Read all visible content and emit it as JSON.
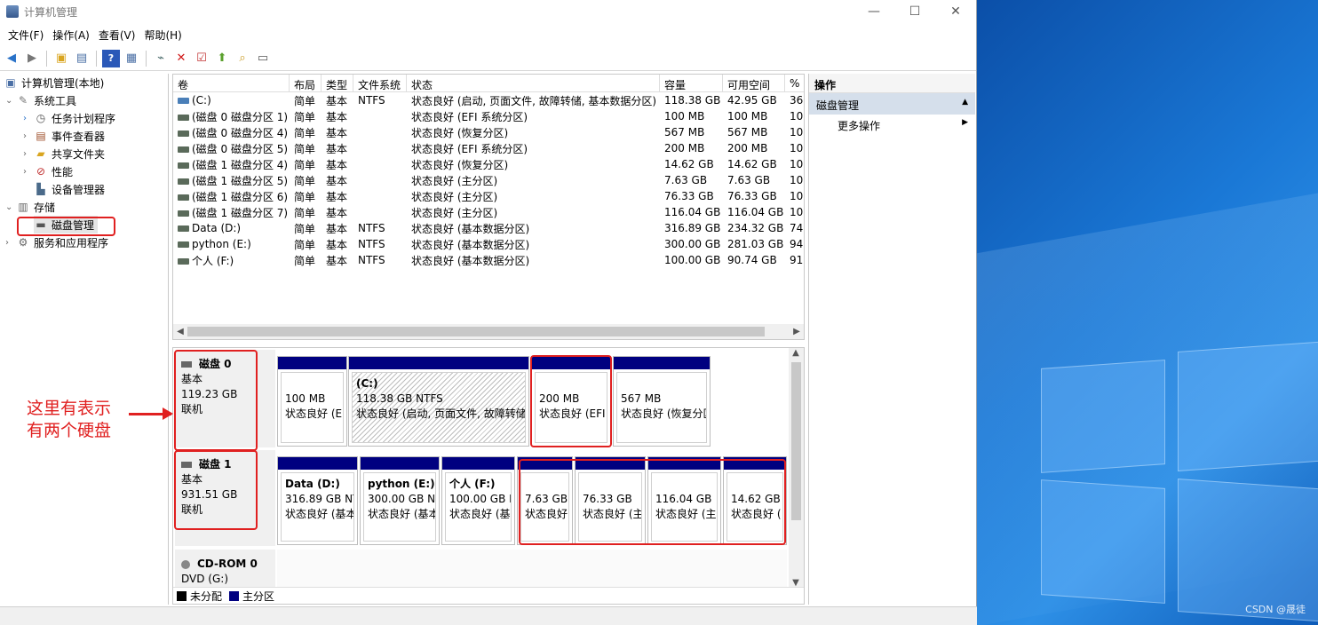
{
  "window": {
    "title": "计算机管理",
    "controls": {
      "minimize": "—",
      "maximize": "☐",
      "close": "✕"
    }
  },
  "menu": [
    "文件(F)",
    "操作(A)",
    "查看(V)",
    "帮助(H)"
  ],
  "toolbar_icons": [
    "back-icon",
    "forward-icon",
    "up-folder-icon",
    "show-hide-tree-icon",
    "help-icon",
    "properties-icon",
    "connect-icon",
    "delete-icon",
    "check-icon",
    "import-icon",
    "search-icon",
    "view-icon"
  ],
  "tree": {
    "root": "计算机管理(本地)",
    "system_tools": "系统工具",
    "task_scheduler": "任务计划程序",
    "event_viewer": "事件查看器",
    "shared_folders": "共享文件夹",
    "performance": "性能",
    "device_manager": "设备管理器",
    "storage": "存储",
    "disk_management": "磁盘管理",
    "services": "服务和应用程序"
  },
  "volumes": {
    "columns": [
      "卷",
      "布局",
      "类型",
      "文件系统",
      "状态",
      "容量",
      "可用空间",
      "%"
    ],
    "rows": [
      [
        "(C:)",
        "简单",
        "基本",
        "NTFS",
        "状态良好 (启动, 页面文件, 故障转储, 基本数据分区)",
        "118.38 GB",
        "42.95 GB",
        "36"
      ],
      [
        "(磁盘 0 磁盘分区 1)",
        "简单",
        "基本",
        "",
        "状态良好 (EFI 系统分区)",
        "100 MB",
        "100 MB",
        "10"
      ],
      [
        "(磁盘 0 磁盘分区 4)",
        "简单",
        "基本",
        "",
        "状态良好 (恢复分区)",
        "567 MB",
        "567 MB",
        "10"
      ],
      [
        "(磁盘 0 磁盘分区 5)",
        "简单",
        "基本",
        "",
        "状态良好 (EFI 系统分区)",
        "200 MB",
        "200 MB",
        "10"
      ],
      [
        "(磁盘 1 磁盘分区 4)",
        "简单",
        "基本",
        "",
        "状态良好 (恢复分区)",
        "14.62 GB",
        "14.62 GB",
        "10"
      ],
      [
        "(磁盘 1 磁盘分区 5)",
        "简单",
        "基本",
        "",
        "状态良好 (主分区)",
        "7.63 GB",
        "7.63 GB",
        "10"
      ],
      [
        "(磁盘 1 磁盘分区 6)",
        "简单",
        "基本",
        "",
        "状态良好 (主分区)",
        "76.33 GB",
        "76.33 GB",
        "10"
      ],
      [
        "(磁盘 1 磁盘分区 7)",
        "简单",
        "基本",
        "",
        "状态良好 (主分区)",
        "116.04 GB",
        "116.04 GB",
        "10"
      ],
      [
        "Data (D:)",
        "简单",
        "基本",
        "NTFS",
        "状态良好 (基本数据分区)",
        "316.89 GB",
        "234.32 GB",
        "74"
      ],
      [
        "python (E:)",
        "简单",
        "基本",
        "NTFS",
        "状态良好 (基本数据分区)",
        "300.00 GB",
        "281.03 GB",
        "94"
      ],
      [
        "个人 (F:)",
        "简单",
        "基本",
        "NTFS",
        "状态良好 (基本数据分区)",
        "100.00 GB",
        "90.74 GB",
        "91"
      ]
    ]
  },
  "disks": {
    "disk0": {
      "name": "磁盘 0",
      "type": "基本",
      "size": "119.23 GB",
      "status": "联机"
    },
    "disk1": {
      "name": "磁盘 1",
      "type": "基本",
      "size": "931.51 GB",
      "status": "联机"
    },
    "cdrom": {
      "name": "CD-ROM 0",
      "type": "DVD (G:)"
    },
    "d0p1": {
      "size": "100 MB",
      "status": "状态良好 (E"
    },
    "d0p2": {
      "name": "(C:)",
      "size": "118.38 GB NTFS",
      "status": "状态良好 (启动, 页面文件, 故障转储"
    },
    "d0p3": {
      "size": "200 MB",
      "status": "状态良好 (EFI"
    },
    "d0p4": {
      "size": "567 MB",
      "status": "状态良好 (恢复分区"
    },
    "d1p1": {
      "name": "Data (D:)",
      "size": "316.89 GB NT",
      "status": "状态良好 (基本"
    },
    "d1p2": {
      "name": "python (E:)",
      "size": "300.00 GB NT",
      "status": "状态良好 (基本"
    },
    "d1p3": {
      "name": "个人 (F:)",
      "size": "100.00 GB N",
      "status": "状态良好 (基"
    },
    "d1p4": {
      "size": "7.63 GB",
      "status": "状态良好"
    },
    "d1p5": {
      "size": "76.33 GB",
      "status": "状态良好 (主"
    },
    "d1p6": {
      "size": "116.04 GB",
      "status": "状态良好 (主"
    },
    "d1p7": {
      "size": "14.62 GB",
      "status": "状态良好 ("
    }
  },
  "legend": {
    "unallocated": "未分配",
    "primary": "主分区",
    "unallocated_color": "#000000",
    "primary_color": "#000080"
  },
  "actions": {
    "header": "操作",
    "section": "磁盘管理",
    "more": "更多操作"
  },
  "annotation": {
    "line1": "这里有表示",
    "line2": "有两个硬盘"
  },
  "watermark": "CSDN @晟徒",
  "colors": {
    "highlight": "#e02020",
    "partition_bar": "#000080",
    "action_section": "#d5dfeb"
  }
}
